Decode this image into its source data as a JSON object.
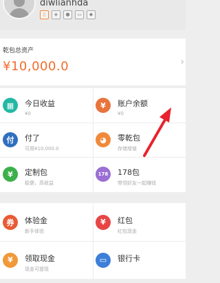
{
  "header": {
    "username": "diwlianhda"
  },
  "assets": {
    "label": "乾包总资产",
    "value": "¥10,000.0"
  },
  "grid1": [
    {
      "title": "今日收益",
      "sub": "¥0",
      "icon": "calendar-icon",
      "color": "#23b8a3",
      "glyph": "▦"
    },
    {
      "title": "账户余额",
      "sub": "¥0",
      "icon": "coin-icon",
      "color": "#e8743c",
      "glyph": "¥"
    },
    {
      "title": "付了",
      "sub": "可用¥10,000.0",
      "icon": "pay-icon",
      "color": "#2f6fbf",
      "glyph": "付"
    },
    {
      "title": "零乾包",
      "sub": "存储增值",
      "icon": "piggy-bank-icon",
      "color": "#f08a3a",
      "glyph": "◕"
    },
    {
      "title": "定制包",
      "sub": "稳健，高收益",
      "icon": "money-bag-icon",
      "color": "#3cb04a",
      "glyph": "¥"
    },
    {
      "title": "178包",
      "sub": "带领好友一起赚钱",
      "icon": "wallet-icon",
      "color": "#9b6fd3",
      "glyph": "178"
    }
  ],
  "grid2": [
    {
      "title": "体验金",
      "sub": "新手体验",
      "icon": "ticket-icon",
      "color": "#e85a36",
      "glyph": "券"
    },
    {
      "title": "红包",
      "sub": "红包现金",
      "icon": "red-envelope-icon",
      "color": "#e84545",
      "glyph": "¥"
    },
    {
      "title": "领取现金",
      "sub": "现金可提现",
      "icon": "cash-icon",
      "color": "#f0993a",
      "glyph": "¥"
    },
    {
      "title": "银行卡",
      "sub": "",
      "icon": "bank-card-icon",
      "color": "#3d7fd8",
      "glyph": "▭"
    }
  ],
  "colors": {
    "accent": "#f26c2d",
    "annotation_arrow": "#e8232d"
  }
}
